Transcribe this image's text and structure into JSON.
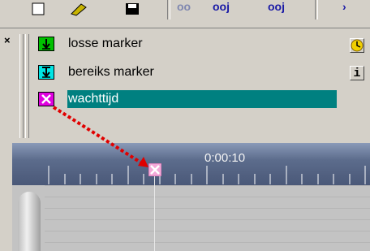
{
  "toolbar": {
    "buttons": [
      {
        "name": "page-icon"
      },
      {
        "name": "edit-icon"
      },
      {
        "name": "save-icon"
      }
    ],
    "text_buttons": [
      "oo",
      "ooj",
      "ooj"
    ],
    "arrow": "›"
  },
  "markers": {
    "items": [
      {
        "label": "losse marker",
        "icon_color": "#00c000",
        "icon": "arrow-down-icon"
      },
      {
        "label": "bereiks marker",
        "icon_color": "#00e5e5",
        "icon": "range-arrow-icon"
      },
      {
        "label": "wachttijd",
        "icon_color": "#e000e0",
        "icon": "x-mark-icon",
        "selected": true
      }
    ],
    "close": "×",
    "info": "i"
  },
  "timeline": {
    "time": "0:00:10"
  },
  "colors": {
    "selection": "#008080",
    "annotation_arrow": "#e00000"
  }
}
